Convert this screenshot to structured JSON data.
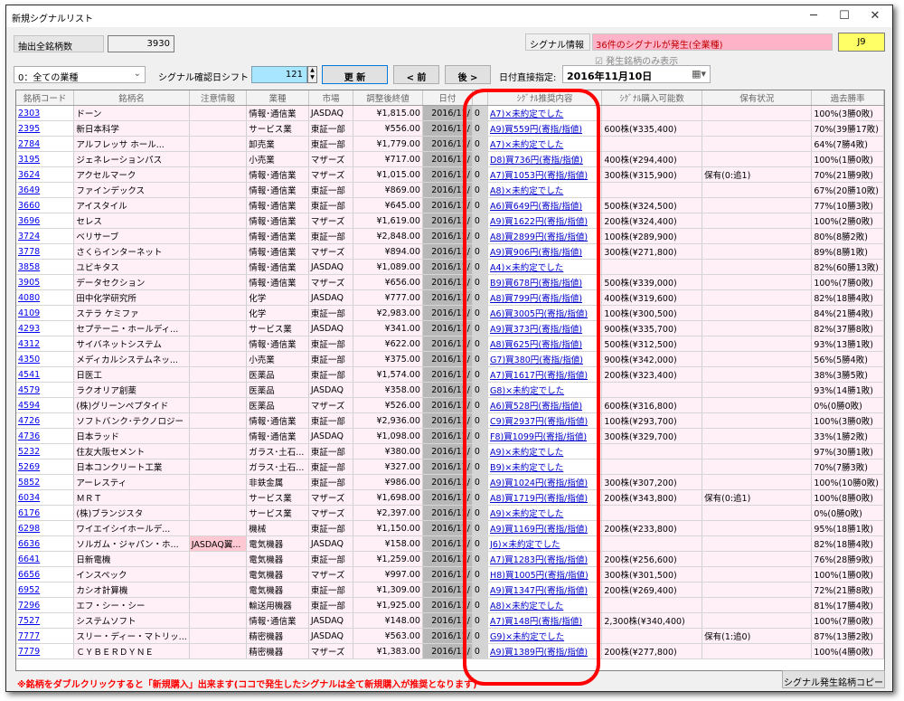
{
  "window": {
    "title": "新規シグナルリスト",
    "minimize": "─",
    "maximize": "☐",
    "close": "✕"
  },
  "toolbar": {
    "count_label": "抽出全銘柄数",
    "count_value": "3930",
    "signal_info_label": "シグナル情報",
    "signal_info_value": "36件のシグナルが発生(全業種)",
    "signal_info_code": "J9",
    "only_signal_checkbox": "発生銘柄のみ表示",
    "industry_select": "0：全ての業種",
    "shift_label": "シグナル確認日シフト",
    "shift_value": "121",
    "refresh_button": "更 新",
    "prev_button": "< 前",
    "next_button": "後 >",
    "date_label": "日付直接指定:",
    "date_value": "2016年11月10日"
  },
  "table": {
    "headers": [
      "銘柄コード",
      "銘柄名",
      "注意情報",
      "業種",
      "市場",
      "調整後終値",
      "日付",
      "",
      "ｼｸﾞﾅﾙ推奨内容",
      "ｼｸﾞﾅﾙ購入可能数",
      "保有状況",
      "過去勝率"
    ],
    "rows": [
      [
        "2303",
        "ドーン",
        "",
        "情報･通信業",
        "JASDAQ",
        "¥1,815.00",
        "2016/11/",
        "0",
        "A7)×未約定でした",
        "",
        "",
        "100%(3勝0敗)"
      ],
      [
        "2395",
        "新日本科学",
        "",
        "サービス業",
        "東証一部",
        "¥556.00",
        "2016/11/",
        "0",
        "A9)買559円(寄指/指値)",
        "600株(¥335,400)",
        "",
        "70%(39勝17敗)"
      ],
      [
        "2784",
        "アルフレッサ ホール...",
        "",
        "卸売業",
        "東証一部",
        "¥1,779.00",
        "2016/11/",
        "0",
        "A7)×未約定でした",
        "",
        "",
        "64%(7勝4敗)"
      ],
      [
        "3195",
        "ジェネレーションパス",
        "",
        "小売業",
        "マザーズ",
        "¥717.00",
        "2016/11/",
        "0",
        "D8)買736円(寄指/指値)",
        "400株(¥294,400)",
        "",
        "100%(1勝0敗)"
      ],
      [
        "3624",
        "アクセルマーク",
        "",
        "情報･通信業",
        "マザーズ",
        "¥1,015.00",
        "2016/11/",
        "0",
        "A7)買1053円(寄指/指値)",
        "300株(¥315,900)",
        "保有(0:追1)",
        "70%(21勝9敗)"
      ],
      [
        "3649",
        "ファインデックス",
        "",
        "情報･通信業",
        "東証一部",
        "¥869.00",
        "2016/11/",
        "0",
        "A8)×未約定でした",
        "",
        "",
        "67%(20勝10敗)"
      ],
      [
        "3660",
        "アイスタイル",
        "",
        "情報･通信業",
        "東証一部",
        "¥645.00",
        "2016/11/",
        "0",
        "A6)買649円(寄指/指値)",
        "500株(¥324,500)",
        "",
        "77%(10勝3敗)"
      ],
      [
        "3696",
        "セレス",
        "",
        "情報･通信業",
        "マザーズ",
        "¥1,619.00",
        "2016/11/",
        "0",
        "A9)買1622円(寄指/指値)",
        "200株(¥324,400)",
        "",
        "100%(2勝0敗)"
      ],
      [
        "3724",
        "ベリサーブ",
        "",
        "情報･通信業",
        "東証一部",
        "¥2,848.00",
        "2016/11/",
        "0",
        "A8)買2899円(寄指/指値)",
        "100株(¥289,900)",
        "",
        "80%(8勝2敗)"
      ],
      [
        "3778",
        "さくらインターネット",
        "",
        "情報･通信業",
        "マザーズ",
        "¥894.00",
        "2016/11/",
        "0",
        "A9)買906円(寄指/指値)",
        "300株(¥271,800)",
        "",
        "89%(8勝1敗)"
      ],
      [
        "3858",
        "ユビキタス",
        "",
        "情報･通信業",
        "JASDAQ",
        "¥1,089.00",
        "2016/11/",
        "0",
        "A4)×未約定でした",
        "",
        "",
        "82%(60勝13敗)"
      ],
      [
        "3905",
        "データセクション",
        "",
        "情報･通信業",
        "マザーズ",
        "¥656.00",
        "2016/11/",
        "0",
        "B9)買678円(寄指/指値)",
        "500株(¥339,000)",
        "",
        "100%(7勝0敗)"
      ],
      [
        "4080",
        "田中化学研究所",
        "",
        "化学",
        "JASDAQ",
        "¥777.00",
        "2016/11/",
        "0",
        "A8)買799円(寄指/指値)",
        "400株(¥319,600)",
        "",
        "82%(18勝4敗)"
      ],
      [
        "4109",
        "ステラ ケミファ",
        "",
        "化学",
        "東証一部",
        "¥2,983.00",
        "2016/11/",
        "0",
        "A6)買3005円(寄指/指値)",
        "100株(¥300,500)",
        "",
        "84%(21勝4敗)"
      ],
      [
        "4293",
        "セプテーニ・ホールディ...",
        "",
        "サービス業",
        "JASDAQ",
        "¥341.00",
        "2016/11/",
        "0",
        "A9)買373円(寄指/指値)",
        "900株(¥335,700)",
        "",
        "82%(37勝8敗)"
      ],
      [
        "4312",
        "サイバネットシステム",
        "",
        "情報･通信業",
        "東証一部",
        "¥622.00",
        "2016/11/",
        "0",
        "A8)買625円(寄指/指値)",
        "500株(¥312,500)",
        "",
        "93%(13勝1敗)"
      ],
      [
        "4350",
        "メディカルシステムネッ...",
        "",
        "小売業",
        "東証一部",
        "¥375.00",
        "2016/11/",
        "0",
        "G7)買380円(寄指/指値)",
        "900株(¥342,000)",
        "",
        "56%(5勝4敗)"
      ],
      [
        "4541",
        "日医工",
        "",
        "医薬品",
        "東証一部",
        "¥1,574.00",
        "2016/11/",
        "0",
        "A7)買1617円(寄指/指値)",
        "200株(¥323,400)",
        "",
        "38%(3勝5敗)"
      ],
      [
        "4579",
        "ラクオリア創薬",
        "",
        "医薬品",
        "JASDAQ",
        "¥358.00",
        "2016/11/",
        "0",
        "G8)×未約定でした",
        "",
        "",
        "93%(14勝1敗)"
      ],
      [
        "4594",
        "(株)グリーンペプタイド",
        "",
        "医薬品",
        "マザーズ",
        "¥526.00",
        "2016/11/",
        "0",
        "A6)買528円(寄指/指値)",
        "600株(¥316,800)",
        "",
        "0%(0勝0敗)"
      ],
      [
        "4726",
        "ソフトバンク･テクノロジー",
        "",
        "情報･通信業",
        "東証一部",
        "¥2,936.00",
        "2016/11/",
        "0",
        "C9)買2937円(寄指/指値)",
        "100株(¥293,700)",
        "",
        "100%(3勝0敗)"
      ],
      [
        "4736",
        "日本ラッド",
        "",
        "情報･通信業",
        "JASDAQ",
        "¥1,098.00",
        "2016/11/",
        "0",
        "F8)買1099円(寄指/指値)",
        "300株(¥329,700)",
        "",
        "33%(1勝2敗)"
      ],
      [
        "5232",
        "住友大阪セメント",
        "",
        "ガラス･土石...",
        "東証一部",
        "¥380.00",
        "2016/11/",
        "0",
        "A9)×未約定でした",
        "",
        "",
        "97%(30勝1敗)"
      ],
      [
        "5269",
        "日本コンクリート工業",
        "",
        "ガラス･土石...",
        "東証一部",
        "¥327.00",
        "2016/11/",
        "0",
        "B9)×未約定でした",
        "",
        "",
        "70%(7勝3敗)"
      ],
      [
        "5852",
        "アーレスティ",
        "",
        "非鉄金属",
        "東証一部",
        "¥986.00",
        "2016/11/",
        "0",
        "A9)買1024円(寄指/指値)",
        "300株(¥307,200)",
        "",
        "100%(10勝0敗)"
      ],
      [
        "6034",
        "ＭＲＴ",
        "",
        "サービス業",
        "マザーズ",
        "¥1,698.00",
        "2016/11/",
        "0",
        "A8)買1719円(寄指/指値)",
        "200株(¥343,800)",
        "保有(0:追1)",
        "100%(8勝0敗)"
      ],
      [
        "6176",
        "(株)ブランジスタ",
        "",
        "サービス業",
        "マザーズ",
        "¥2,397.00",
        "2016/11/",
        "0",
        "A9)×未約定でした",
        "",
        "",
        "0%(0勝0敗)"
      ],
      [
        "6298",
        "ワイエイシイホールデ...",
        "",
        "機械",
        "東証一部",
        "¥1,150.00",
        "2016/11/",
        "0",
        "A9)買1169円(寄指/指値)",
        "200株(¥233,800)",
        "",
        "95%(18勝1敗)"
      ],
      [
        "6636",
        "ソルガム・ジャパン・ホ...",
        "JASDAQ翼...",
        "電気機器",
        "JASDAQ",
        "¥158.00",
        "2016/11/",
        "0",
        "J6)×未約定でした",
        "",
        "",
        "82%(18勝4敗)"
      ],
      [
        "6641",
        "日新電機",
        "",
        "電気機器",
        "東証一部",
        "¥1,259.00",
        "2016/11/",
        "0",
        "A7)買1283円(寄指/指値)",
        "200株(¥256,600)",
        "",
        "76%(28勝9敗)"
      ],
      [
        "6656",
        "インスペック",
        "",
        "電気機器",
        "マザーズ",
        "¥997.00",
        "2016/11/",
        "0",
        "H8)買1005円(寄指/指値)",
        "300株(¥301,500)",
        "",
        "100%(1勝0敗)"
      ],
      [
        "6952",
        "カシオ計算機",
        "",
        "電気機器",
        "東証一部",
        "¥1,309.00",
        "2016/11/",
        "0",
        "A9)買1347円(寄指/指値)",
        "200株(¥269,400)",
        "",
        "72%(21勝8敗)"
      ],
      [
        "7296",
        "エフ・シー・シー",
        "",
        "輸送用機器",
        "東証一部",
        "¥1,925.00",
        "2016/11/",
        "0",
        "A8)×未約定でした",
        "",
        "",
        "81%(17勝4敗)"
      ],
      [
        "7527",
        "システムソフト",
        "",
        "情報･通信業",
        "JASDAQ",
        "¥148.00",
        "2016/11/",
        "0",
        "A7)買148円(寄指/指値)",
        "2,300株(¥340,400)",
        "",
        "100%(7勝0敗)"
      ],
      [
        "7777",
        "スリー・ディー・マトリッ...",
        "",
        "精密機器",
        "JASDAQ",
        "¥563.00",
        "2016/11/",
        "0",
        "G9)×未約定でした",
        "",
        "保有(1:追0)",
        "87%(13勝2敗)"
      ],
      [
        "7779",
        "ＣＹＢＥＲＤＹＮＥ",
        "",
        "精密機器",
        "マザーズ",
        "¥1,383.00",
        "2016/11/",
        "0",
        "A9)買1389円(寄指/指値)",
        "200株(¥277,800)",
        "",
        "100%(4勝0敗)"
      ]
    ]
  },
  "footer": {
    "note": "※銘柄をダブルクリックすると「新規購入」出来ます(ココで発生したシグナルは全て新規購入が推奨となります)",
    "copy_button": "シグナル発生銘柄コピー"
  }
}
